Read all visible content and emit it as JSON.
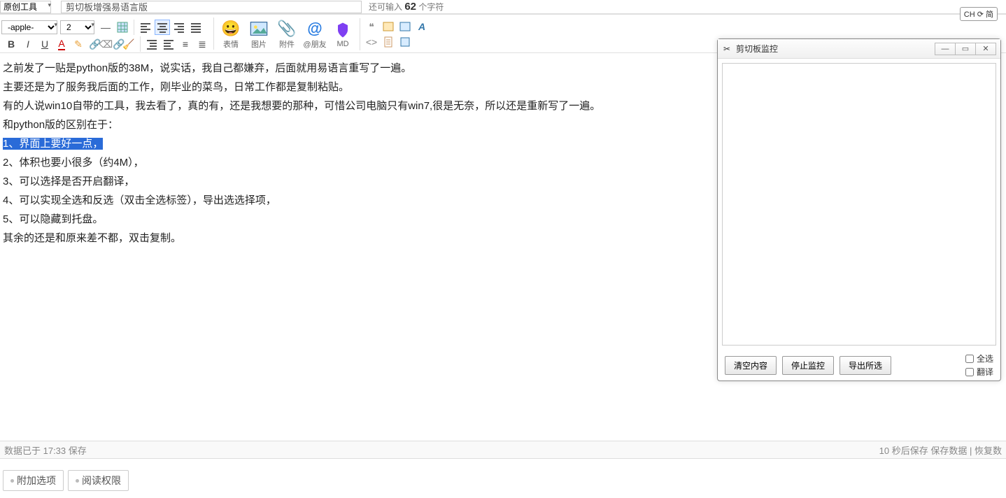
{
  "top": {
    "category": "原创工具",
    "title": "剪切板增强易语言版",
    "char_hint_prefix": "还可输入 ",
    "char_count": "62",
    "char_hint_suffix": " 个字符"
  },
  "ime": {
    "label": "CH ⟳ 简"
  },
  "toolbar": {
    "font_select": "-apple-",
    "size_select": "2",
    "big_icons": {
      "emoji": "表情",
      "image": "图片",
      "attach": "附件",
      "at": "@朋友",
      "md": "MD"
    }
  },
  "editor": {
    "p1": "之前发了一贴是python版的38M，说实话，我自己都嫌弃，后面就用易语言重写了一遍。",
    "p2": "主要还是为了服务我后面的工作，刚毕业的菜鸟，日常工作都是复制粘贴。",
    "p3": "有的人说win10自带的工具，我去看了，真的有，还是我想要的那种，可惜公司电脑只有win7,很是无奈，所以还是重新写了一遍。",
    "p4": "和python版的区别在于：",
    "p5": "1、界面上要好一点，",
    "p6": "2、体积也要小很多（约4M），",
    "p7": "3、可以选择是否开启翻译，",
    "p8": "4、可以实现全选和反选（双击全选标签），导出选选择项，",
    "p9": "5、可以隐藏到托盘。",
    "p10": "其余的还是和原来差不都，双击复制。"
  },
  "status": {
    "left": "数据已于 17:33 保存",
    "auto": "10 秒后保存",
    "save": "保存数据",
    "restore": "恢复数"
  },
  "bottom_tabs": {
    "extra": "附加选项",
    "perm": "阅读权限"
  },
  "floatwin": {
    "title": "剪切板监控",
    "btn_clear": "清空内容",
    "btn_stop": "停止监控",
    "btn_export": "导出所选",
    "chk_all": "全选",
    "chk_trans": "翻译"
  }
}
